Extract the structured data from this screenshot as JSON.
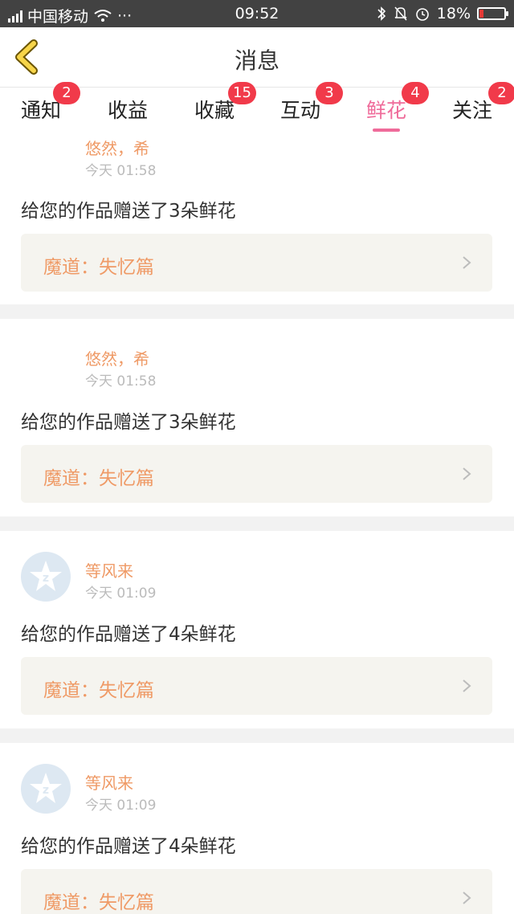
{
  "status_bar": {
    "network": "4G",
    "carrier": "中国移动",
    "more": "···",
    "time": "09:52",
    "battery_percent": "18%",
    "battery_level": 0.18,
    "battery_color": "#e53935"
  },
  "header": {
    "title": "消息",
    "back_icon": "chevron-left-icon"
  },
  "tabs": [
    {
      "label": "通知",
      "badge": "2"
    },
    {
      "label": "收益",
      "badge": ""
    },
    {
      "label": "收藏",
      "badge": "15"
    },
    {
      "label": "互动",
      "badge": "3"
    },
    {
      "label": "鲜花",
      "badge": "4",
      "active": true
    },
    {
      "label": "关注",
      "badge": "2"
    }
  ],
  "colors": {
    "accent": "#ef6b9a",
    "badge": "#f13a4a",
    "name": "#ef9a66"
  },
  "messages": [
    {
      "user": "悠然，希",
      "time": "今天 01:58",
      "text": "给您的作品赠送了3朵鲜花",
      "work_title": "魔道：失忆篇",
      "has_avatar": false
    },
    {
      "user": "悠然，希",
      "time": "今天 01:58",
      "text": "给您的作品赠送了3朵鲜花",
      "work_title": "魔道：失忆篇",
      "has_avatar": false
    },
    {
      "user": "等风来",
      "time": "今天 01:09",
      "text": "给您的作品赠送了4朵鲜花",
      "work_title": "魔道：失忆篇",
      "has_avatar": true
    },
    {
      "user": "等风来",
      "time": "今天 01:09",
      "text": "给您的作品赠送了4朵鲜花",
      "work_title": "魔道：失忆篇",
      "has_avatar": true
    }
  ]
}
